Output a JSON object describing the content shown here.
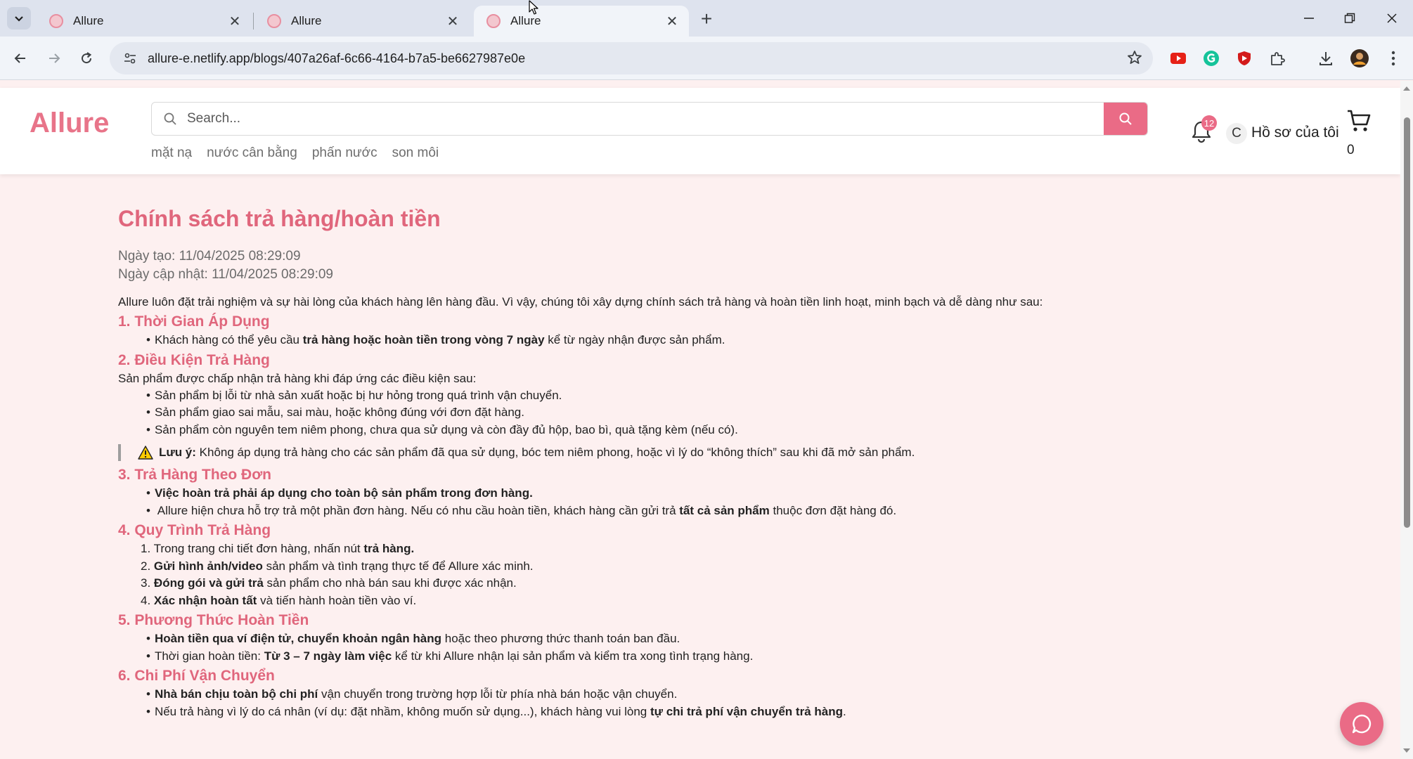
{
  "browser": {
    "tabs": [
      {
        "title": "Allure",
        "active": false
      },
      {
        "title": "Allure",
        "active": false
      },
      {
        "title": "Allure",
        "active": true
      }
    ],
    "url": "allure-e.netlify.app/blogs/407a26af-6c66-4164-b7a5-be6627987e0e"
  },
  "header": {
    "logo": "Allure",
    "search_placeholder": "Search...",
    "categories": [
      "mặt nạ",
      "nước cân bằng",
      "phấn nước",
      "son môi"
    ],
    "notification_count": "12",
    "avatar_initial": "C",
    "profile_label": "Hồ sơ của tôi",
    "cart_count": "0"
  },
  "article": {
    "title": "Chính sách trả hàng/hoàn tiền",
    "created": "Ngày tạo: 11/04/2025 08:29:09",
    "updated": "Ngày cập nhật: 11/04/2025 08:29:09",
    "intro": "Allure luôn đặt trải nghiệm và sự hài lòng của khách hàng lên hàng đầu. Vì vậy, chúng tôi xây dựng chính sách trả hàng và hoàn tiền linh hoạt, minh bạch và dễ dàng như sau:",
    "s1": {
      "title": "1. Thời Gian Áp Dụng",
      "i1": {
        "a": "Khách hàng có thể yêu cầu ",
        "b": "trả hàng hoặc hoàn tiền trong vòng 7 ngày",
        "c": " kể từ ngày nhận được sản phẩm."
      }
    },
    "s2": {
      "title": "2. Điều Kiện Trả Hàng",
      "lead": "Sản phẩm được chấp nhận trả hàng khi đáp ứng các điều kiện sau:",
      "items": [
        "Sản phẩm bị lỗi từ nhà sản xuất hoặc bị hư hỏng trong quá trình vận chuyển.",
        "Sản phẩm giao sai mẫu, sai màu, hoặc không đúng với đơn đặt hàng.",
        "Sản phẩm còn nguyên tem niêm phong, chưa qua sử dụng và còn đầy đủ hộp, bao bì, quà tặng kèm (nếu có)."
      ],
      "note_label": "Lưu ý:",
      "note_text": " Không áp dụng trả hàng cho các sản phẩm đã qua sử dụng, bóc tem niêm phong, hoặc vì lý do “không thích” sau khi đã mở sản phẩm."
    },
    "s3": {
      "title": "3. Trả Hàng Theo Đơn",
      "i1": "Việc hoàn trả phải áp dụng cho toàn bộ sản phẩm trong đơn hàng.",
      "i2": {
        "a": " Allure hiện chưa hỗ trợ trả một phần đơn hàng. Nếu có nhu cầu hoàn tiền, khách hàng cần gửi trả ",
        "b": "tất cả sản phẩm",
        "c": " thuộc đơn đặt hàng đó."
      }
    },
    "s4": {
      "title": "4. Quy Trình Trả Hàng",
      "st1": {
        "n": "1.",
        "a": "Trong trang chi tiết đơn hàng, nhấn nút ",
        "b": "trả hàng."
      },
      "st2": {
        "n": "2.",
        "b": "Gửi hình ảnh/video",
        "c": " sản phẩm và tình trạng thực tế để Allure xác minh."
      },
      "st3": {
        "n": "3.",
        "b": "Đóng gói và gửi trả",
        "c": " sản phẩm cho nhà bán sau khi được xác nhận."
      },
      "st4": {
        "n": "4.",
        "b": "Xác nhận hoàn tất",
        "c": " và tiến hành hoàn tiền vào ví."
      }
    },
    "s5": {
      "title": "5. Phương Thức Hoàn Tiền",
      "i1": {
        "b": "Hoàn tiền qua ví điện tử, chuyển khoản ngân hàng",
        "c": " hoặc theo phương thức thanh toán ban đầu."
      },
      "i2": {
        "a": "Thời gian hoàn tiền: ",
        "b": "Từ 3 – 7 ngày làm việc",
        "c": " kể từ khi Allure nhận lại sản phẩm và kiểm tra xong tình trạng hàng."
      }
    },
    "s6": {
      "title": "6. Chi Phí Vận Chuyển",
      "i1": {
        "b": "Nhà bán chịu toàn bộ chi phí",
        "c": " vận chuyển trong trường hợp lỗi từ phía nhà bán hoặc vận chuyển."
      },
      "i2": {
        "a": "Nếu trả hàng vì lý do cá nhân (ví dụ: đặt nhầm, không muốn sử dụng...), khách hàng vui lòng ",
        "b": "tự chi trả phí vận chuyển trả hàng",
        "c": "."
      }
    }
  },
  "colors": {
    "brand": "#e87489",
    "heading": "#e0667c",
    "page_bg": "#fdf0f0"
  }
}
